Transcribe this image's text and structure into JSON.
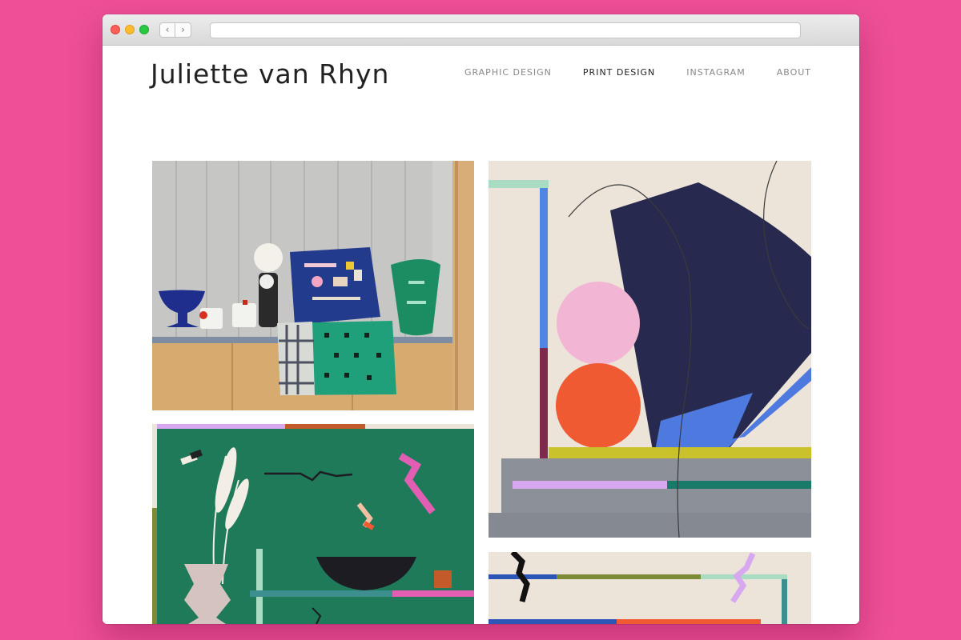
{
  "site": {
    "title": "Juliette van Rhyn"
  },
  "nav": {
    "items": [
      "GRAPHIC DESIGN",
      "PRINT DESIGN",
      "INSTAGRAM",
      "ABOUT"
    ],
    "active": "PRINT DESIGN"
  },
  "browser": {
    "back_glyph": "‹",
    "forward_glyph": "›",
    "url": ""
  },
  "colors": {
    "background": "#ee4f97",
    "navy": "#2a2d52",
    "pink": "#f2b6d4",
    "orange": "#ef5a33",
    "green": "#1f7a5a",
    "teal": "#1a8c7a",
    "lilac": "#d7a8f0",
    "olive": "#7d8a36",
    "beige": "#ece3d9"
  },
  "gallery": {
    "tiles": [
      "interior-cushions-photo",
      "abstract-navy-print",
      "green-plant-print",
      "abstract-line-print"
    ]
  }
}
